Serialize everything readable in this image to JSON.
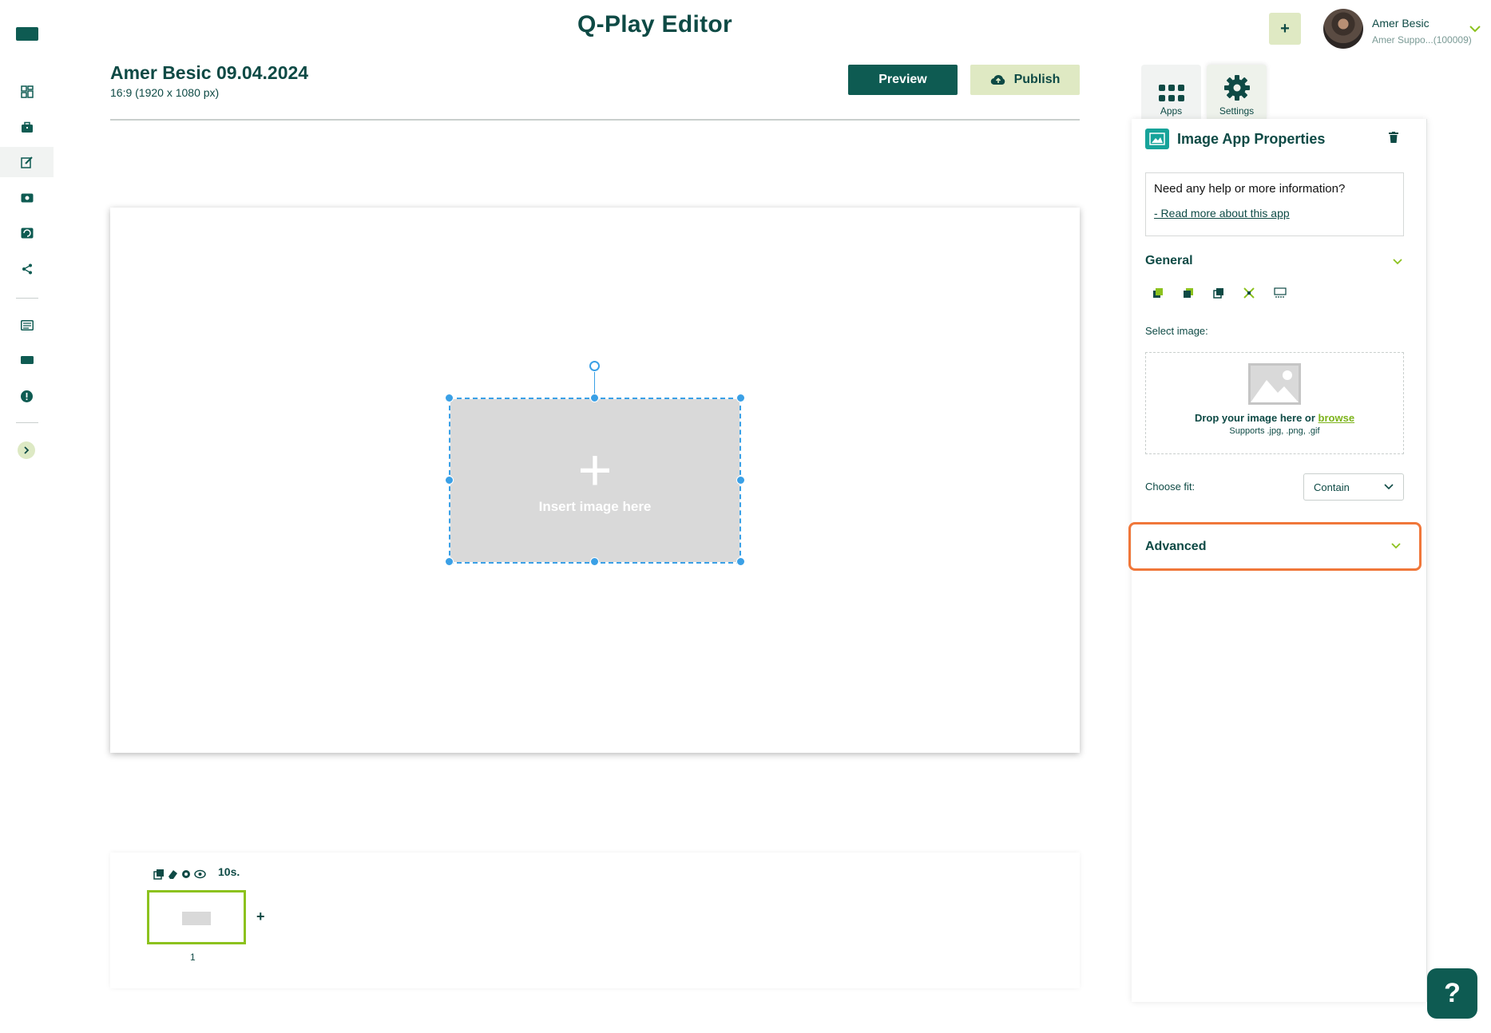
{
  "app": {
    "title": "Q-Play Editor"
  },
  "user": {
    "name": "Amer Besic",
    "subtitle": "Amer Suppo...(100009)"
  },
  "topbar": {
    "add_label": "+"
  },
  "project": {
    "title": "Amer Besic 09.04.2024",
    "resolution": "16:9 (1920 x 1080 px)"
  },
  "actions": {
    "preview_label": "Preview",
    "publish_label": "Publish"
  },
  "sidebar": {
    "items": [
      {
        "icon": "dashboard-icon"
      },
      {
        "icon": "briefcase-icon"
      },
      {
        "icon": "edit-icon",
        "active": true
      },
      {
        "icon": "media-icon"
      },
      {
        "icon": "refresh-screen-icon"
      },
      {
        "icon": "share-icon"
      },
      {
        "icon": "list-card-icon"
      },
      {
        "icon": "screen-icon"
      },
      {
        "icon": "alert-icon"
      }
    ],
    "expand_icon": "chevron-right-icon"
  },
  "canvas": {
    "placeholder_plus": "+",
    "placeholder_text": "Insert image here"
  },
  "timeline": {
    "duration": "10s.",
    "slide_number": "1",
    "add_label": "+"
  },
  "panel": {
    "tabs": [
      {
        "label": "Apps",
        "icon": "apps-grid-icon"
      },
      {
        "label": "Settings",
        "icon": "gear-icon"
      }
    ],
    "title": "Image App Properties",
    "help": {
      "question": "Need any help or more information?",
      "link": "- Read more about this app"
    },
    "general": {
      "title": "General"
    },
    "select_image": {
      "label": "Select image:",
      "drop_text": "Drop your image here or",
      "browse": "browse",
      "supports": "Supports .jpg, .png, .gif"
    },
    "fit": {
      "label": "Choose fit:",
      "value": "Contain"
    },
    "advanced": {
      "title": "Advanced"
    }
  },
  "help_fab": {
    "label": "?"
  },
  "colors": {
    "primary": "#0e5b52",
    "accent_light": "#dfe9c3",
    "accent_green": "#8cc21e",
    "selection": "#3aa0e6",
    "highlight": "#f0773a"
  }
}
